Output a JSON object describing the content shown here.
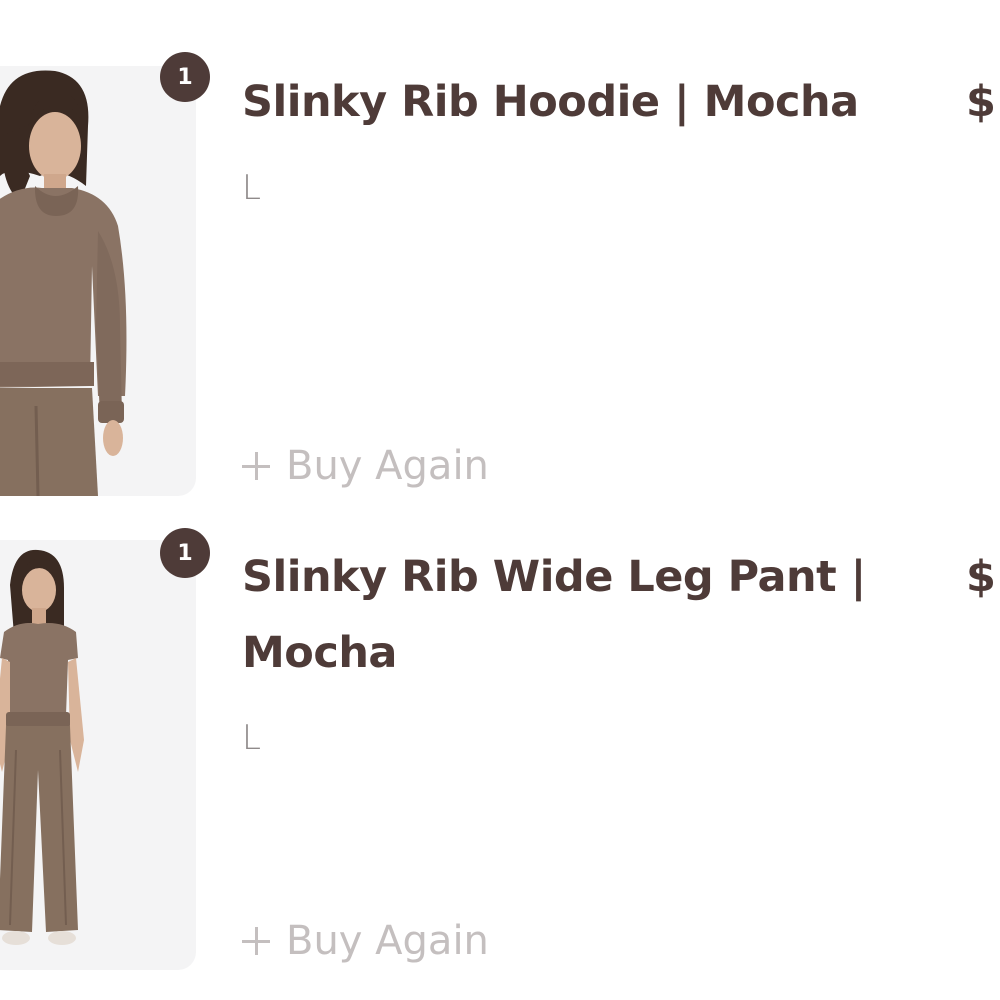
{
  "colors": {
    "brand_text": "#4e3b38",
    "variant_text": "#8f8a8a",
    "action_text": "#c4bfbf",
    "thumbnail_background": "#f4f4f5",
    "product_mocha": "#8a7364"
  },
  "items": [
    {
      "quantity": "1",
      "title": "Slinky Rib Hoodie | Mocha",
      "price": "$",
      "variant": "L",
      "buy_again_label": "Buy Again",
      "buy_again_icon": "plus-icon",
      "image_icon": "product-photo-hoodie"
    },
    {
      "quantity": "1",
      "title": "Slinky Rib Wide Leg Pant | Mocha",
      "price": "$",
      "variant": "L",
      "buy_again_label": "Buy Again",
      "buy_again_icon": "plus-icon",
      "image_icon": "product-photo-pant"
    }
  ]
}
